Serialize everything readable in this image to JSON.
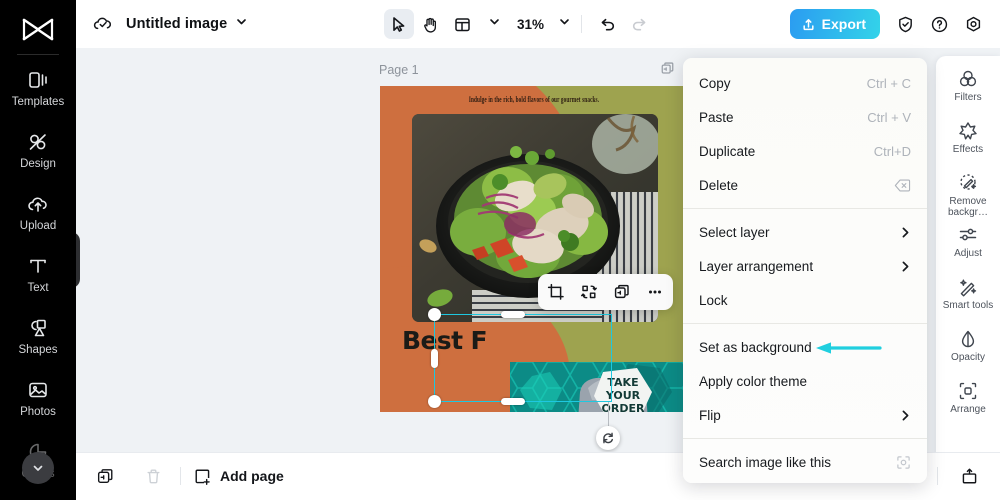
{
  "app": {
    "left_rail": {
      "logo_icon": "capcut-logo-icon",
      "items": [
        {
          "label": "Templates",
          "icon": "templates-icon"
        },
        {
          "label": "Design",
          "icon": "design-icon"
        },
        {
          "label": "Upload",
          "icon": "upload-cloud-icon"
        },
        {
          "label": "Text",
          "icon": "text-icon"
        },
        {
          "label": "Shapes",
          "icon": "shapes-icon"
        },
        {
          "label": "Photos",
          "icon": "photos-icon"
        },
        {
          "label": "Colors",
          "icon": "colors-icon"
        }
      ],
      "scroll_down_icon": "chevron-down-icon",
      "collapse_icon": "chevron-right-icon"
    },
    "topbar": {
      "cloud_icon": "cloud-saved-icon",
      "doc_title": "Untitled image",
      "title_caret_icon": "chevron-down-icon",
      "tools": [
        {
          "name": "select-tool",
          "icon": "cursor-arrow-icon",
          "active": true
        },
        {
          "name": "hand-tool",
          "icon": "hand-icon",
          "active": false
        },
        {
          "name": "layout-tool",
          "icon": "layout-grid-icon",
          "active": false
        }
      ],
      "layout_caret_icon": "chevron-down-icon",
      "zoom_level": "31%",
      "zoom_caret_icon": "chevron-down-icon",
      "undo_icon": "undo-icon",
      "redo_icon": "redo-icon",
      "export_label": "Export",
      "export_icon": "upload-share-icon",
      "shield_icon": "shield-check-icon",
      "help_icon": "question-circle-icon",
      "settings_icon": "gear-hex-icon"
    },
    "canvas": {
      "page_label": "Page 1",
      "page_duplicate_icon": "duplicate-page-icon",
      "design": {
        "tagline": "Indulge in the rich, bold flavors of our gourmet snacks.",
        "headline": "Best F",
        "selected_element_text_lines": [
          "TAKE",
          "YOUR",
          "ORDER"
        ]
      },
      "float_toolbar": [
        {
          "name": "crop-button",
          "icon": "crop-icon"
        },
        {
          "name": "remove-background-button",
          "icon": "remove-bg-icon"
        },
        {
          "name": "duplicate-button",
          "icon": "duplicate-icon"
        },
        {
          "name": "more-options-button",
          "icon": "ellipsis-icon"
        }
      ],
      "rotate_icon": "rotate-icon"
    },
    "context_menu": {
      "groups": [
        [
          {
            "label": "Copy",
            "shortcut": "Ctrl + C",
            "chevron": false,
            "trailing_icon": ""
          },
          {
            "label": "Paste",
            "shortcut": "Ctrl + V",
            "chevron": false,
            "trailing_icon": ""
          },
          {
            "label": "Duplicate",
            "shortcut": "Ctrl+D",
            "chevron": false,
            "trailing_icon": ""
          },
          {
            "label": "Delete",
            "shortcut": "",
            "chevron": false,
            "trailing_icon": "backspace-icon"
          }
        ],
        [
          {
            "label": "Select layer",
            "shortcut": "",
            "chevron": true,
            "trailing_icon": ""
          },
          {
            "label": "Layer arrangement",
            "shortcut": "",
            "chevron": true,
            "trailing_icon": ""
          },
          {
            "label": "Lock",
            "shortcut": "",
            "chevron": false,
            "trailing_icon": ""
          }
        ],
        [
          {
            "label": "Set as background",
            "shortcut": "",
            "chevron": false,
            "trailing_icon": "",
            "annotated": true
          },
          {
            "label": "Apply color theme",
            "shortcut": "",
            "chevron": false,
            "trailing_icon": ""
          },
          {
            "label": "Flip",
            "shortcut": "",
            "chevron": true,
            "trailing_icon": ""
          }
        ],
        [
          {
            "label": "Search image like this",
            "shortcut": "",
            "chevron": false,
            "trailing_icon": "scan-image-icon"
          }
        ]
      ],
      "annotation_arrow_color": "#20CFDF",
      "annotation_target": "Set as background"
    },
    "right_panel": {
      "items": [
        {
          "label": "Filters",
          "icon": "filters-icon"
        },
        {
          "label": "Effects",
          "icon": "effects-star-icon"
        },
        {
          "label": "Remove backgr…",
          "icon": "remove-bg-wand-icon"
        },
        {
          "label": "Adjust",
          "icon": "adjust-sliders-icon"
        },
        {
          "label": "Smart tools",
          "icon": "smart-tools-wand-icon"
        },
        {
          "label": "Opacity",
          "icon": "opacity-drop-icon"
        },
        {
          "label": "Arrange",
          "icon": "arrange-icon"
        }
      ]
    },
    "bottombar": {
      "duplicate_page_icon": "duplicate-page-icon",
      "delete_page_icon": "trash-icon",
      "add_page_label": "Add page",
      "add_page_icon": "add-page-icon",
      "next_page_icon": "chevron-right-icon",
      "present_icon": "present-icon"
    },
    "colors": {
      "accent": "#20CFDF",
      "export_gradient_from": "#2B9CF1",
      "export_gradient_to": "#33D3E9",
      "rail_bg": "#000000",
      "canvas_bg": "#EFF2F5",
      "page_olive": "#9EA34F",
      "page_orange": "#CE6F3F",
      "selection_border": "#1EC8E0"
    }
  }
}
